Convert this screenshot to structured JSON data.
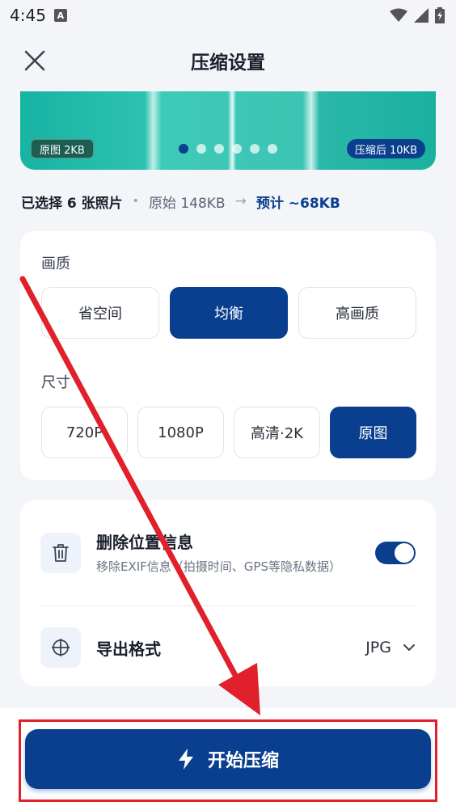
{
  "status": {
    "time": "4:45",
    "notif_letter": "A"
  },
  "header": {
    "title": "压缩设置"
  },
  "preview": {
    "left_tag": "原图 2KB",
    "right_tag": "压缩后 10KB",
    "dot_count": 6,
    "active_dot": 0
  },
  "summary": {
    "selected": "已选择 6 张照片",
    "original": "原始 148KB",
    "arrow": "→",
    "estimate": "预计 ~68KB"
  },
  "quality": {
    "label": "画质",
    "options": [
      "省空间",
      "均衡",
      "高画质"
    ],
    "selected_index": 1
  },
  "size": {
    "label": "尺寸",
    "options": [
      "720P",
      "1080P",
      "高清·2K",
      "原图"
    ],
    "selected_index": 3
  },
  "location": {
    "title": "删除位置信息",
    "subtitle": "移除EXIF信息（拍摄时间、GPS等隐私数据）",
    "enabled": true
  },
  "export": {
    "title": "导出格式",
    "value": "JPG"
  },
  "action": {
    "start_label": "开始压缩"
  },
  "colors": {
    "primary": "#0a3f8f",
    "teal": "#2dc2b1",
    "annotation": "#e0202a"
  }
}
